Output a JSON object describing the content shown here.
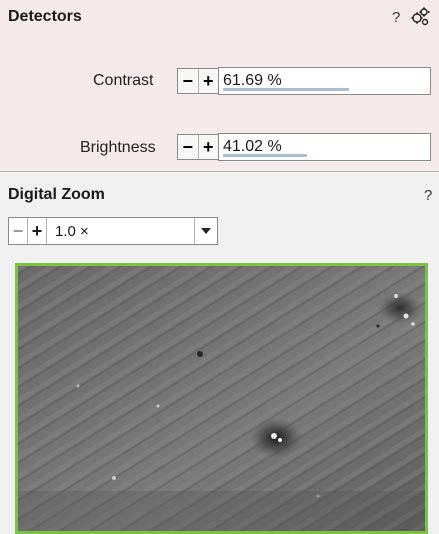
{
  "detectors": {
    "title": "Detectors",
    "help": "?",
    "settings_icon": "gear-cluster-icon",
    "contrast": {
      "label": "Contrast",
      "value": "61.69 %",
      "level_percent": 61.69
    },
    "brightness": {
      "label": "Brightness",
      "value": "41.02 %",
      "level_percent": 41.02
    },
    "stepper_minus": "−",
    "stepper_plus": "+"
  },
  "digital_zoom": {
    "title": "Digital Zoom",
    "help": "?",
    "minus": "−",
    "plus": "+",
    "value": "1.0 ×",
    "dropdown_icon": "triangle-down-icon",
    "preview_image": "sem-grayscale-preview",
    "accent_color": "#7cc242"
  }
}
